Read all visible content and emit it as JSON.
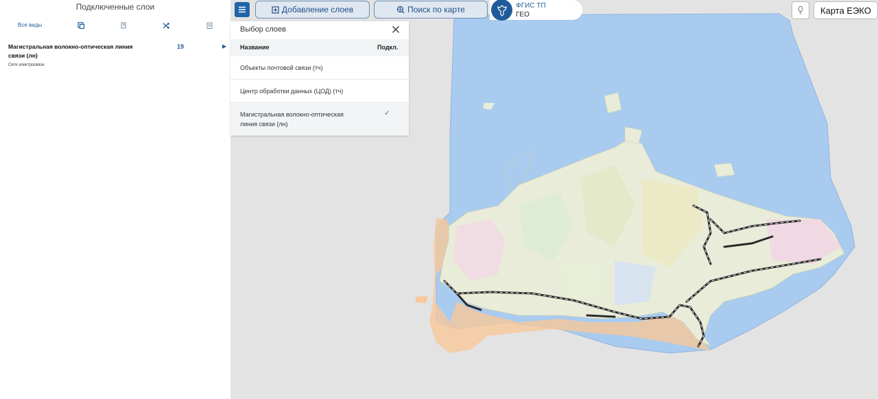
{
  "left_panel": {
    "title": "Подключенные слои",
    "tabs": {
      "all_views": "Все виды"
    },
    "layer": {
      "name": "Магистральная волокно-оптическая линия связи (лн)",
      "count": "19",
      "category": "Сети электросвязи"
    }
  },
  "toolbar": {
    "add_layers": "Добавление слоев",
    "search_map": "Поиск по карте",
    "logo_line1": "ФГИС ТП",
    "logo_line2": "ГЕО",
    "map_name": "Карта ЕЭКО"
  },
  "picker": {
    "title": "Выбор слоев",
    "col_name": "Название",
    "col_connected": "Подкл.",
    "rows": [
      {
        "label": "Объекты почтовой связи (тч)",
        "check": ""
      },
      {
        "label": "Центр обработки данных (ЦОД) (тч)",
        "check": ""
      },
      {
        "label": "Магистральная волокно-оптическая линия связи (лн)",
        "check": "✓"
      }
    ]
  },
  "colors": {
    "accent": "#1f64a8",
    "sea": "#a9cbef",
    "land": "#e9ecd9",
    "border_zone": "#f8c79a",
    "line": "#2a2a2a"
  }
}
